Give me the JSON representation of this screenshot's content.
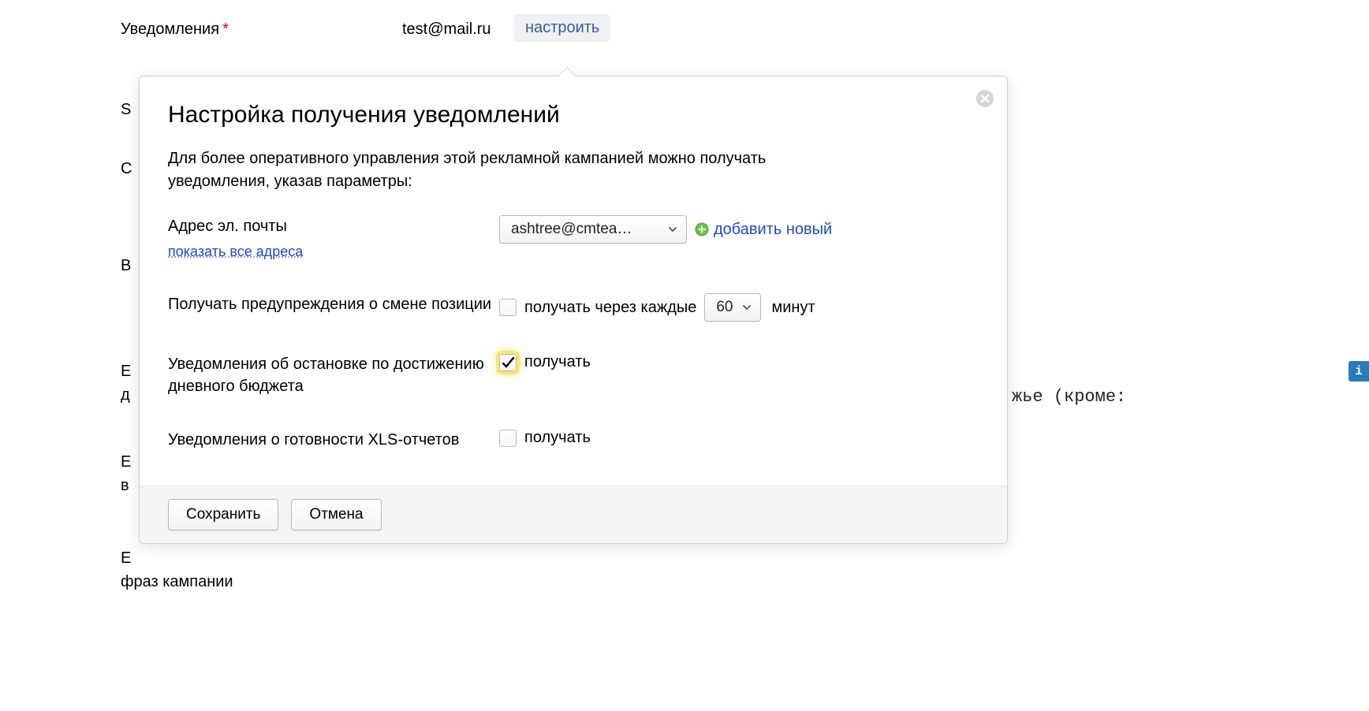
{
  "background": {
    "notifications_label": "Уведомления",
    "required_star": "*",
    "email_value": "test@mail.ru",
    "configure_button": "настроить",
    "right_fragment": "жье (кроме:",
    "letter_s": "S",
    "letter_c": "С",
    "letter_v": "В",
    "letter_e1": "Е",
    "letter_d": "д",
    "letter_e2": "Е",
    "letter_vo": "в",
    "letter_e3": "Е",
    "phrase_campaign": "фраз кампании",
    "info_tab": "i"
  },
  "popup": {
    "title": "Настройка получения уведомлений",
    "description": "Для более оперативного управления этой рекламной кампанией можно получать уведомления, указав параметры:",
    "email": {
      "label": "Адрес эл. почты",
      "show_all_link": "показать все адреса",
      "selected_value": "ashtree@cmtea…",
      "add_new": "добавить новый"
    },
    "position_warnings": {
      "label": "Получать предупреждения о смене позиции",
      "checkbox_label": "получать через каждые",
      "interval_value": "60",
      "unit": "минут",
      "checked": false
    },
    "daily_budget_stop": {
      "label": "Уведомления об остановке по достижению дневного бюджета",
      "checkbox_label": "получать",
      "checked": true
    },
    "xls_reports": {
      "label": "Уведомления о готовности XLS-отчетов",
      "checkbox_label": "получать",
      "checked": false
    },
    "save_button": "Сохранить",
    "cancel_button": "Отмена"
  }
}
